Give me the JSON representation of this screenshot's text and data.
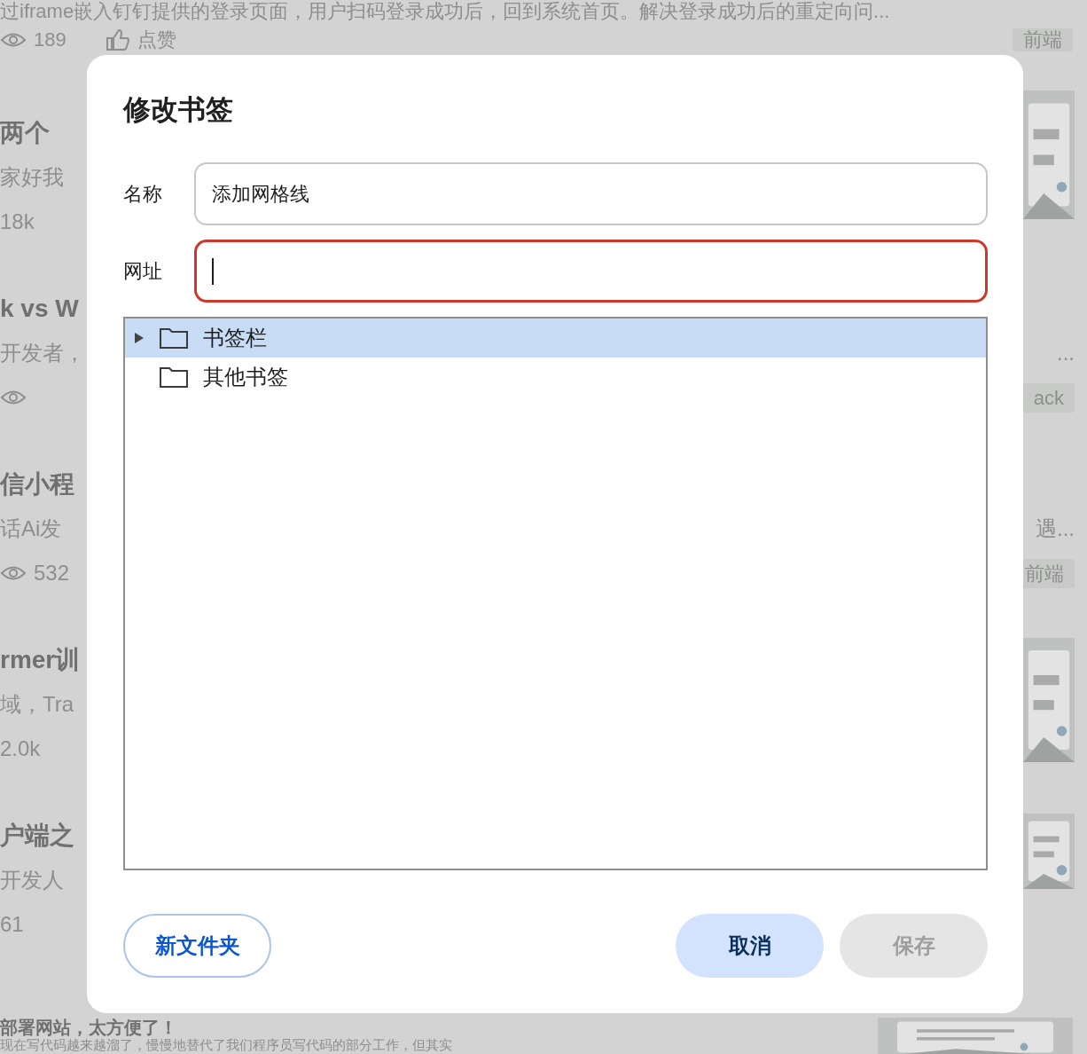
{
  "background": {
    "top": {
      "excerpt": "过iframe嵌入钉钉提供的登录页面，用户扫码登录成功后，回到系统首页。解决登录成功后的重定向问...",
      "views": "189",
      "like": "点赞",
      "tag": "前端"
    },
    "articles": [
      {
        "title": "两个",
        "excerpt": "家好我",
        "eye_icon": false,
        "stat": "18k"
      },
      {
        "title": "k vs W",
        "excerpt": "开发者，",
        "eye_icon": true,
        "right": {
          "kind": "text",
          "excerpt": "...",
          "tag": "ack"
        }
      },
      {
        "title": "信小程",
        "excerpt": "话Ai发",
        "eye_icon": true,
        "stat": "532",
        "right": {
          "kind": "text",
          "excerpt": "遇...",
          "tag": "前端"
        }
      },
      {
        "title": "rmer训",
        "excerpt": "域，Tra",
        "eye_icon": false,
        "stat": "2.0k"
      },
      {
        "title": "户端之",
        "excerpt": "开发人",
        "eye_icon": false,
        "stat": "61"
      }
    ],
    "bottom": {
      "title": "部署网站，太方便了！",
      "excerpt": "现在写代码越来越溜了，慢慢地替代了我们程序员写代码的部分工作，但其实"
    }
  },
  "dialog": {
    "title": "修改书签",
    "fields": [
      {
        "label": "名称",
        "value": "添加网格线",
        "focused": false,
        "invalid": false
      },
      {
        "label": "网址",
        "focused": true,
        "invalid": true
      }
    ],
    "tree": [
      {
        "label": "书签栏",
        "selected": true,
        "expandable": true,
        "expanded": false
      },
      {
        "label": "其他书签",
        "selected": false,
        "expandable": false
      }
    ],
    "buttons": [
      {
        "label": "新文件夹",
        "kind": "outline",
        "disabled": false
      },
      {
        "label": "取消",
        "kind": "tonal",
        "disabled": false
      },
      {
        "label": "保存",
        "kind": "tonal",
        "disabled": true
      }
    ]
  }
}
